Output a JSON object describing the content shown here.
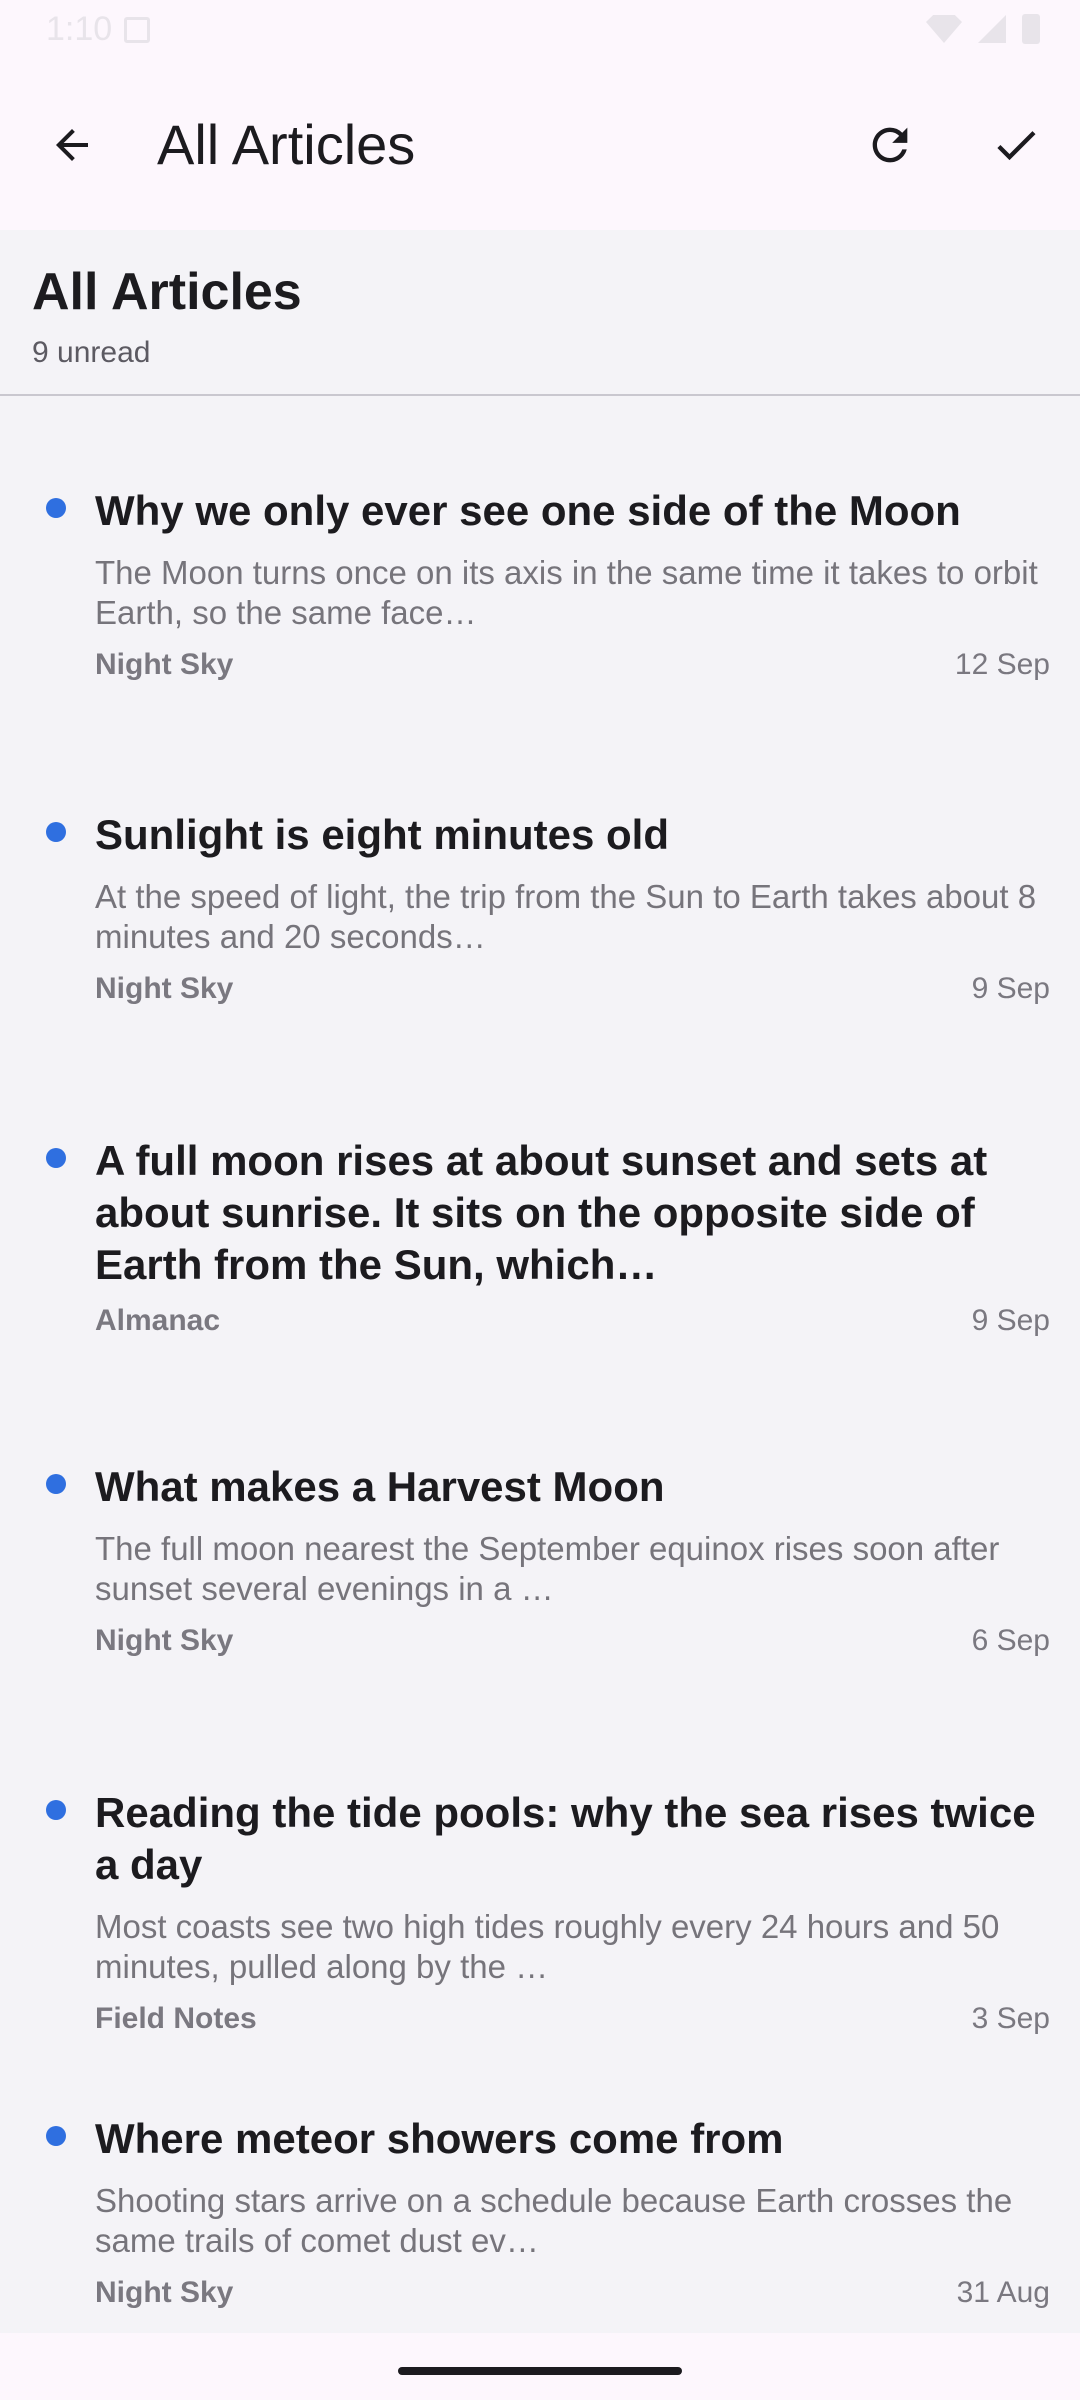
{
  "status": {
    "time": "1:10"
  },
  "app_bar": {
    "title": "All Articles"
  },
  "feed": {
    "title": "All Articles",
    "unread": "9 unread"
  },
  "articles": [
    {
      "title": "Why we only ever see one side of the Moon",
      "snippet": "The Moon turns once on its axis in the same time it takes to orbit Earth, so the same face…",
      "source": "Night Sky",
      "date": "12 Sep"
    },
    {
      "title": "Sunlight is eight minutes old",
      "snippet": "At the speed of light, the trip from the Sun to Earth takes about 8 minutes and 20 seconds…",
      "source": "Night Sky",
      "date": "9 Sep"
    },
    {
      "title": "A full moon rises at about sunset and sets at about sunrise. It sits on the opposite side of Earth from the Sun, which…",
      "snippet": "",
      "source": "Almanac",
      "date": "9 Sep"
    },
    {
      "title": "What makes a Harvest Moon",
      "snippet": "The full moon nearest the September equinox rises soon after sunset several evenings in a …",
      "source": "Night Sky",
      "date": "6 Sep"
    },
    {
      "title": "Reading the tide pools: why the sea rises twice a day",
      "snippet": "Most coasts see two high tides roughly every 24 hours and 50 minutes, pulled along by the …",
      "source": "Field Notes",
      "date": "3 Sep"
    },
    {
      "title": "Where meteor showers come from",
      "snippet": "Shooting stars arrive on a schedule because Earth crosses the same trails of comet dust ev…",
      "source": "Night Sky",
      "date": "31 Aug"
    }
  ],
  "colors": {
    "unread_dot": "#2f6fe0",
    "background": "#f4f3f7",
    "app_bar": "#fdf7fd"
  }
}
